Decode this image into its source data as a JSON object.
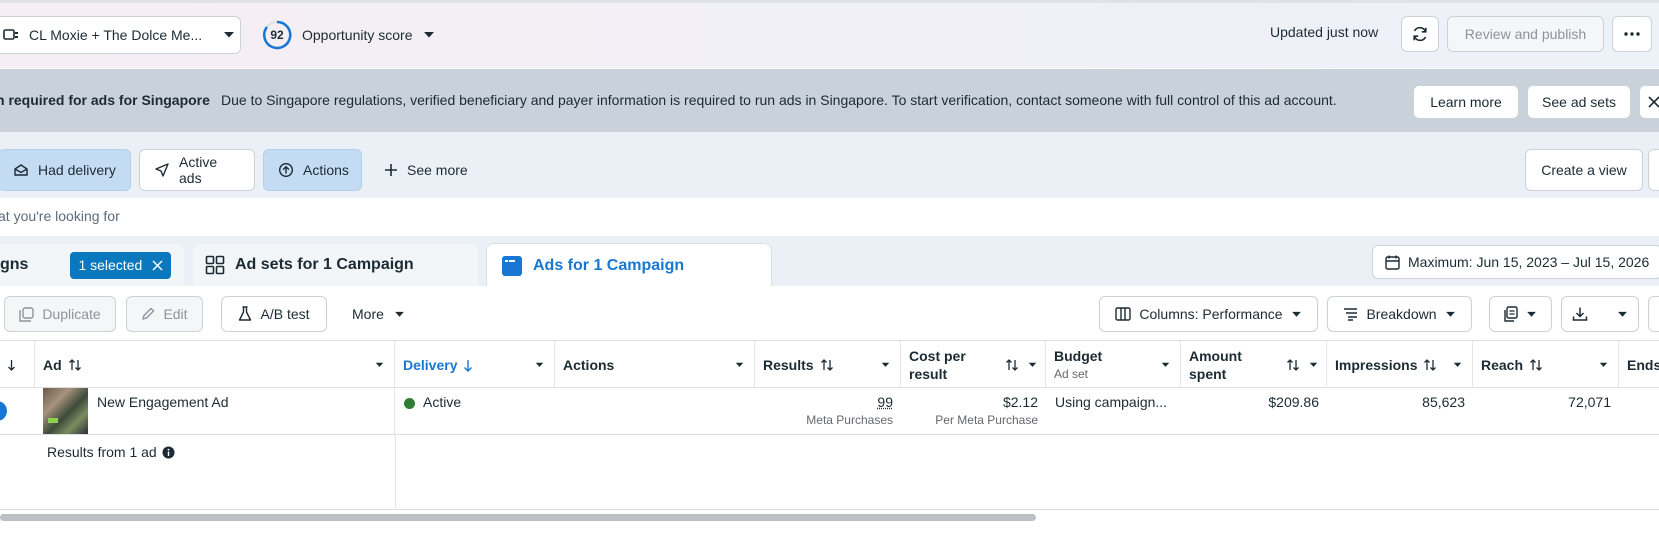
{
  "topbar": {
    "account_name": "CL Moxie + The Dolce Me...",
    "opportunity_score_value": "92",
    "opportunity_score_label": "Opportunity score",
    "updated_text": "Updated just now",
    "review_publish_label": "Review and publish"
  },
  "notice": {
    "title": "n required for ads for Singapore",
    "message": "Due to Singapore regulations, verified beneficiary and payer information is required to run ads in Singapore. To start verification, contact someone with full control of this ad account.",
    "learn_more_label": "Learn more",
    "see_ad_sets_label": "See ad sets"
  },
  "filters": {
    "had_delivery": "Had delivery",
    "active_ads": "Active ads",
    "actions": "Actions",
    "see_more": "See more",
    "create_view": "Create a view"
  },
  "search": {
    "placeholder": "at you're looking for"
  },
  "tabs": {
    "campaigns_partial": "gns",
    "selected_pill": "1 selected",
    "ad_sets": "Ad sets for 1 Campaign",
    "ads": "Ads for 1 Campaign",
    "date_range": "Maximum: Jun 15, 2023 – Jul 15, 2026"
  },
  "toolbar": {
    "duplicate": "Duplicate",
    "edit": "Edit",
    "ab_test": "A/B test",
    "more": "More",
    "columns": "Columns: Performance",
    "breakdown": "Breakdown"
  },
  "table": {
    "headers": {
      "ad": "Ad",
      "delivery": "Delivery",
      "actions": "Actions",
      "results": "Results",
      "cost_per_result": "Cost per result",
      "budget": "Budget",
      "budget_sub": "Ad set",
      "amount_spent": "Amount spent",
      "impressions": "Impressions",
      "reach": "Reach",
      "ends": "Ends"
    },
    "rows": [
      {
        "ad_name": "New Engagement Ad",
        "delivery": "Active",
        "results": "99",
        "results_sub": "Meta Purchases",
        "cost_per_result": "$2.12",
        "cost_sub": "Per Meta Purchase",
        "budget": "Using campaign...",
        "amount_spent": "$209.86",
        "impressions": "85,623",
        "reach": "72,071"
      }
    ],
    "footer": "Results from 1 ad"
  },
  "colors": {
    "accent_blue": "#1877d3",
    "active_green": "#2e7d32",
    "selected_pill": "#0a78be",
    "notice_bg": "#c9d1da"
  }
}
